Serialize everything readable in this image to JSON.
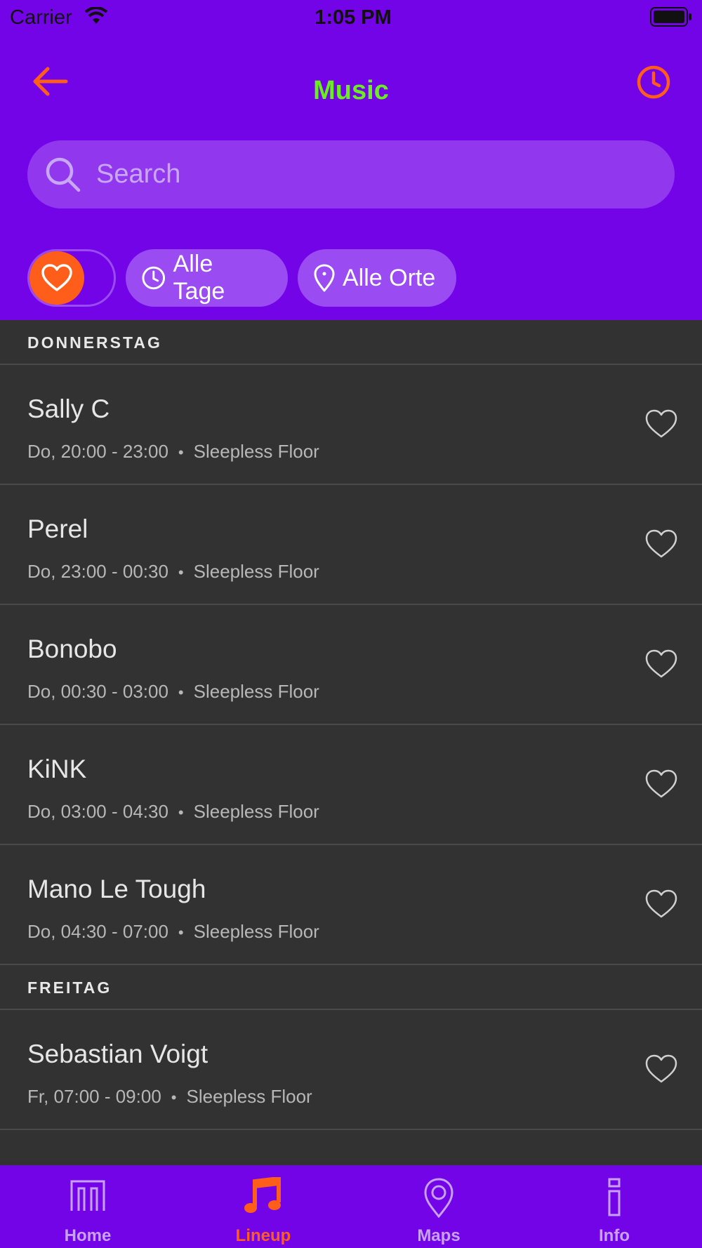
{
  "colors": {
    "header_bg": "#7404E8",
    "title": "#69EE1E",
    "accent": "#FF5E1A",
    "list_bg": "#323232"
  },
  "status_bar": {
    "carrier": "Carrier",
    "time": "1:05 PM"
  },
  "header": {
    "title": "Music",
    "back_icon": "arrow-left-icon",
    "history_icon": "clock-icon"
  },
  "search": {
    "placeholder": "Search"
  },
  "filters": {
    "favorites_toggle_icon": "heart-icon",
    "days_label": "Alle Tage",
    "places_label": "Alle Orte"
  },
  "sections": [
    {
      "title": "DONNERSTAG",
      "items": [
        {
          "name": "Sally C",
          "time": "Do, 20:00 - 23:00",
          "location": "Sleepless Floor"
        },
        {
          "name": "Perel",
          "time": "Do, 23:00 - 00:30",
          "location": "Sleepless Floor"
        },
        {
          "name": "Bonobo",
          "time": "Do, 00:30 - 03:00",
          "location": "Sleepless Floor"
        },
        {
          "name": "KiNK",
          "time": "Do, 03:00 - 04:30",
          "location": "Sleepless Floor"
        },
        {
          "name": "Mano Le Tough",
          "time": "Do, 04:30 - 07:00",
          "location": "Sleepless Floor"
        }
      ]
    },
    {
      "title": "FREITAG",
      "items": [
        {
          "name": "Sebastian Voigt",
          "time": "Fr, 07:00 - 09:00",
          "location": "Sleepless Floor"
        }
      ]
    }
  ],
  "separator": "•",
  "tab_bar": [
    {
      "label": "Home",
      "icon": "home-icon",
      "active": false
    },
    {
      "label": "Lineup",
      "icon": "music-note-icon",
      "active": true
    },
    {
      "label": "Maps",
      "icon": "map-pin-icon",
      "active": false
    },
    {
      "label": "Info",
      "icon": "info-icon",
      "active": false
    }
  ]
}
